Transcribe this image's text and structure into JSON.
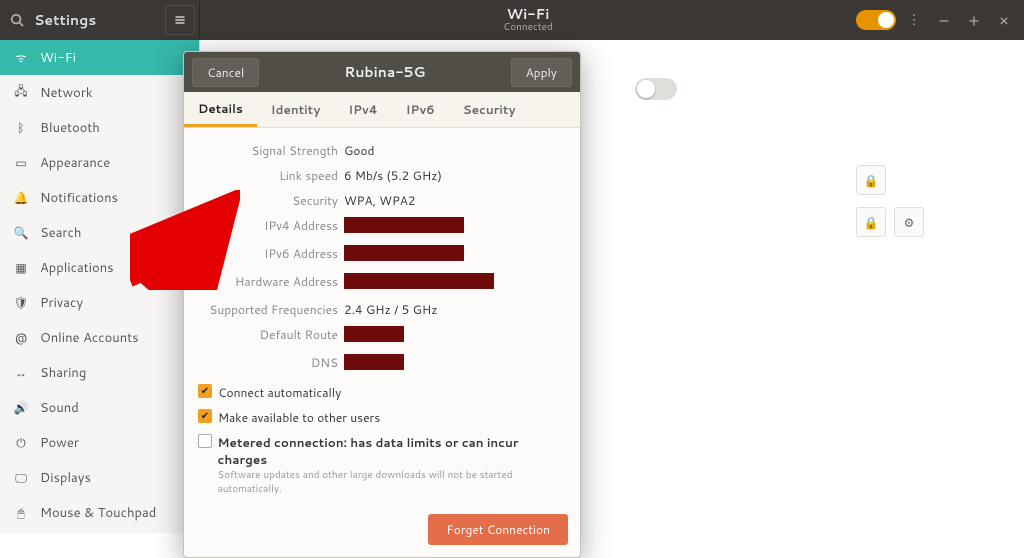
{
  "header": {
    "app_title": "Settings",
    "page_title": "Wi-Fi",
    "page_subtitle": "Connected"
  },
  "sidebar": {
    "items": [
      {
        "label": "Wi-Fi",
        "icon": "wifi-icon",
        "active": true
      },
      {
        "label": "Network",
        "icon": "network-icon"
      },
      {
        "label": "Bluetooth",
        "icon": "bluetooth-icon"
      },
      {
        "label": "Appearance",
        "icon": "appearance-icon"
      },
      {
        "label": "Notifications",
        "icon": "notifications-icon"
      },
      {
        "label": "Search",
        "icon": "search-icon"
      },
      {
        "label": "Applications",
        "icon": "apps-icon",
        "chevron": true
      },
      {
        "label": "Privacy",
        "icon": "privacy-icon",
        "chevron": true
      },
      {
        "label": "Online Accounts",
        "icon": "online-accounts-icon"
      },
      {
        "label": "Sharing",
        "icon": "sharing-icon"
      },
      {
        "label": "Sound",
        "icon": "sound-icon"
      },
      {
        "label": "Power",
        "icon": "power-icon"
      },
      {
        "label": "Displays",
        "icon": "displays-icon"
      },
      {
        "label": "Mouse & Touchpad",
        "icon": "mouse-icon"
      }
    ]
  },
  "dialog": {
    "cancel": "Cancel",
    "apply": "Apply",
    "title": "Rubina-5G",
    "tabs": [
      "Details",
      "Identity",
      "IPv4",
      "IPv6",
      "Security"
    ],
    "active_tab": "Details",
    "rows": [
      {
        "label": "Signal Strength",
        "value": "Good"
      },
      {
        "label": "Link speed",
        "value": "6 Mb/s (5.2 GHz)"
      },
      {
        "label": "Security",
        "value": "WPA, WPA2"
      },
      {
        "label": "IPv4 Address",
        "value": "",
        "redacted": true
      },
      {
        "label": "IPv6 Address",
        "value": "",
        "redacted": true
      },
      {
        "label": "Hardware Address",
        "value": "",
        "redacted": true,
        "wide": true
      },
      {
        "label": "Supported Frequencies",
        "value": "2.4 GHz / 5 GHz"
      },
      {
        "label": "Default Route",
        "value": "",
        "redacted": true,
        "small": true
      },
      {
        "label": "DNS",
        "value": "",
        "redacted": true,
        "small": true
      }
    ],
    "checks": {
      "auto": {
        "label": "Connect automatically",
        "checked": true
      },
      "share": {
        "label": "Make available to other users",
        "checked": true
      },
      "metered": {
        "label": "Metered connection: has data limits or can incur charges",
        "sub": "Software updates and other large downloads will not be started automatically.",
        "checked": false
      }
    },
    "forget": "Forget Connection"
  }
}
